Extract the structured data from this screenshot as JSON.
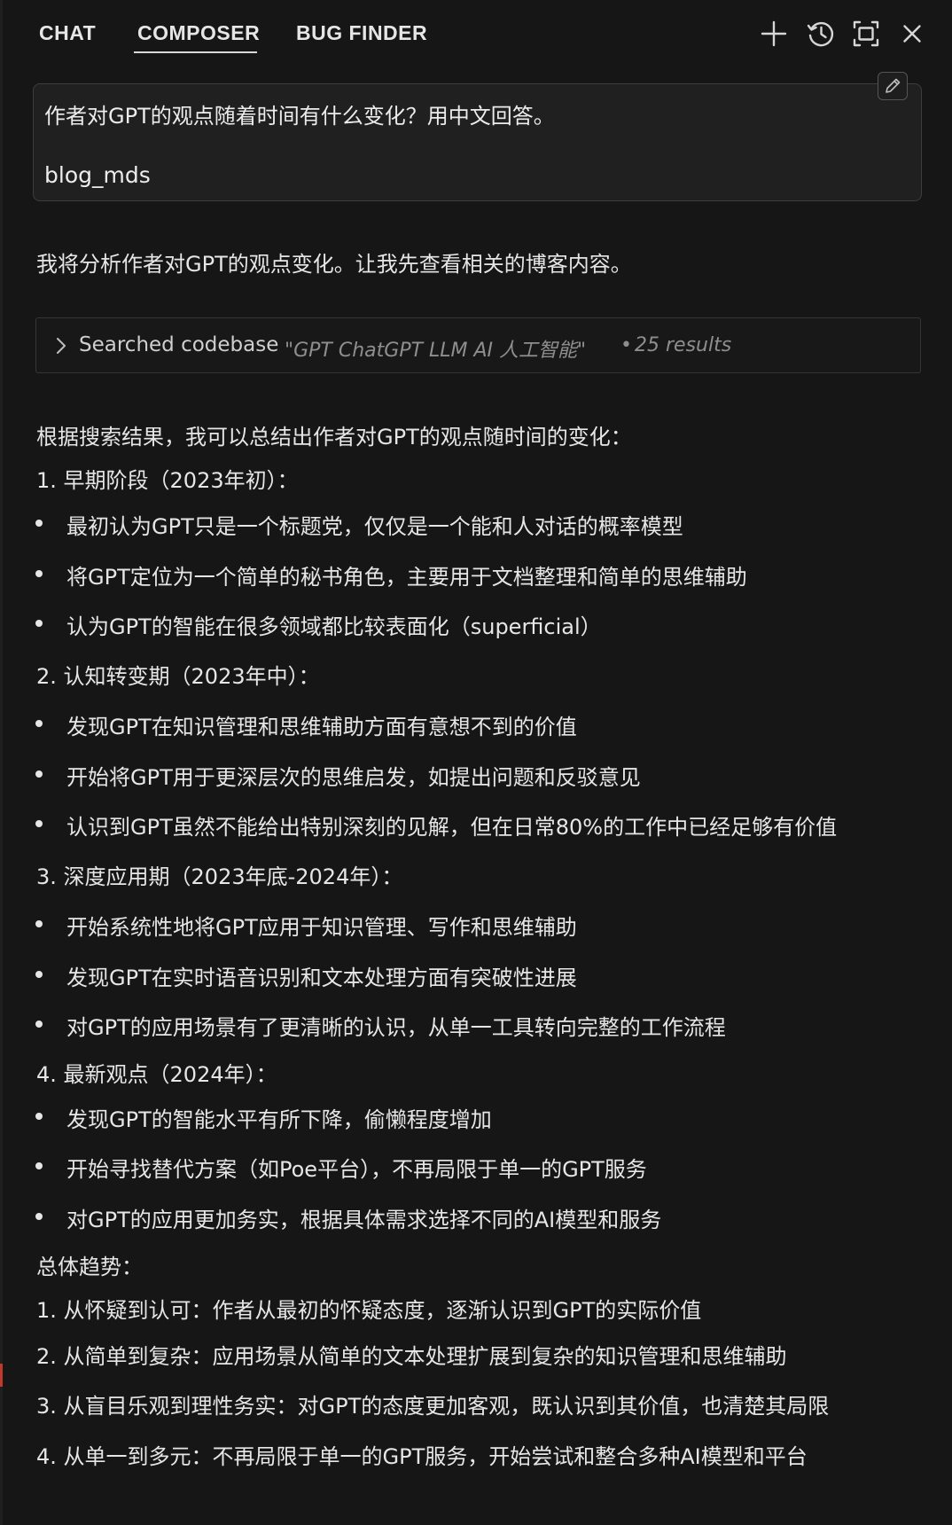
{
  "header": {
    "tabs": [
      {
        "label": "CHAT"
      },
      {
        "label": "COMPOSER"
      },
      {
        "label": "BUG FINDER"
      }
    ],
    "icons": [
      "plus-icon",
      "history-icon",
      "maximize-icon",
      "close-icon"
    ]
  },
  "prompt": {
    "question": "作者对GPT的观点随着时间有什么变化？用中文回答。",
    "context": "blog_mds"
  },
  "response": {
    "intro": "我将分析作者对GPT的观点变化。让我先查看相关的博客内容。",
    "search": {
      "action": "Searched codebase",
      "query": "\"GPT ChatGPT LLM AI 人工智能\"",
      "separator": "•",
      "count": "25 results"
    },
    "summary_intro": "根据搜索结果，我可以总结出作者对GPT的观点随时间的变化：",
    "phases": [
      {
        "heading": "1. 早期阶段（2023年初）：",
        "bullets": [
          "最初认为GPT只是一个标题党，仅仅是一个能和人对话的概率模型",
          "将GPT定位为一个简单的秘书角色，主要用于文档整理和简单的思维辅助",
          "认为GPT的智能在很多领域都比较表面化（superficial）"
        ]
      },
      {
        "heading": "2. 认知转变期（2023年中）：",
        "bullets": [
          "发现GPT在知识管理和思维辅助方面有意想不到的价值",
          "开始将GPT用于更深层次的思维启发，如提出问题和反驳意见",
          "认识到GPT虽然不能给出特别深刻的见解，但在日常80%的工作中已经足够有价值"
        ]
      },
      {
        "heading": "3. 深度应用期（2023年底-2024年）：",
        "bullets": [
          "开始系统性地将GPT应用于知识管理、写作和思维辅助",
          "发现GPT在实时语音识别和文本处理方面有突破性进展",
          "对GPT的应用场景有了更清晰的认识，从单一工具转向完整的工作流程"
        ]
      },
      {
        "heading": "4. 最新观点（2024年）：",
        "bullets": [
          "发现GPT的智能水平有所下降，偷懒程度增加",
          "开始寻找替代方案（如Poe平台），不再局限于单一的GPT服务",
          "对GPT的应用更加务实，根据具体需求选择不同的AI模型和服务"
        ]
      }
    ],
    "trend_heading": "总体趋势：",
    "trends": [
      "1. 从怀疑到认可：作者从最初的怀疑态度，逐渐认识到GPT的实际价值",
      "2. 从简单到复杂：应用场景从简单的文本处理扩展到复杂的知识管理和思维辅助",
      "3. 从盲目乐观到理性务实：对GPT的态度更加客观，既认识到其价值，也清楚其局限",
      "4. 从单一到多元：不再局限于单一的GPT服务，开始尝试和整合多种AI模型和平台"
    ]
  }
}
